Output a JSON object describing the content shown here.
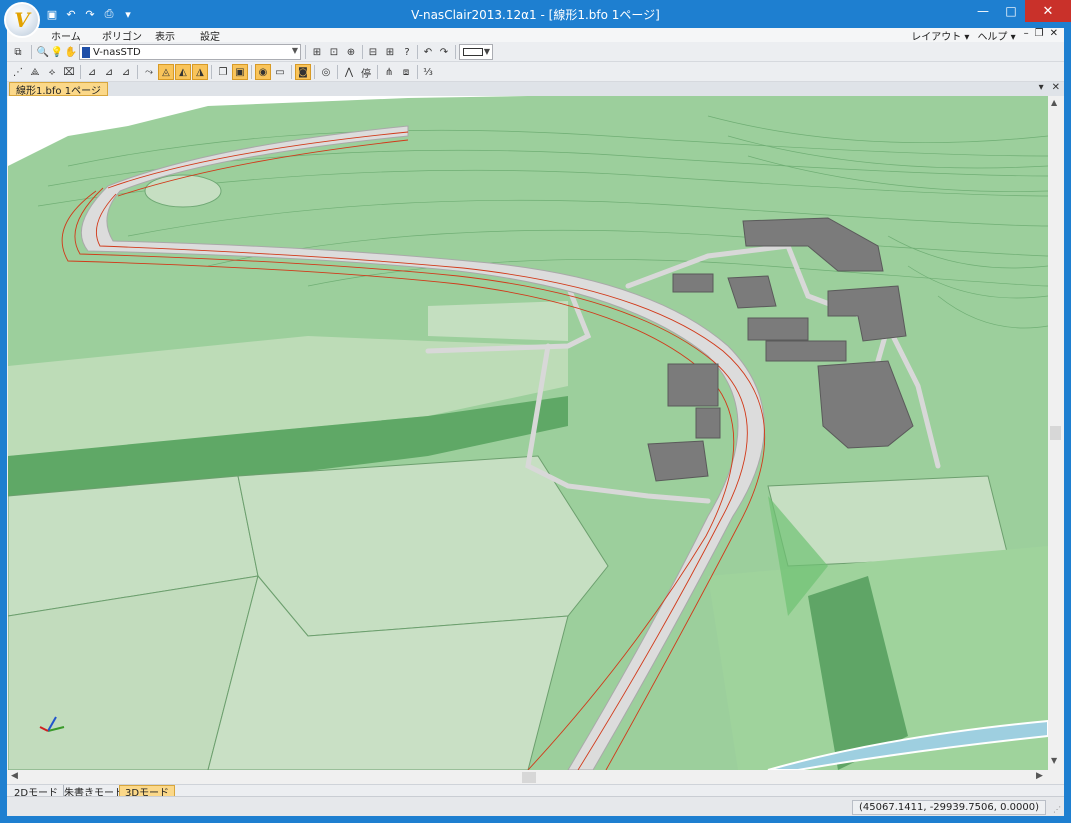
{
  "window": {
    "title": "V-nasClair2013.12α1 - [線形1.bfo 1ページ]",
    "logo_text": "V",
    "controls": {
      "minimize": "—",
      "maximize": "□",
      "close": "✕"
    }
  },
  "menu": {
    "items": [
      "ホーム",
      "ポリゴン",
      "表示",
      "設定"
    ],
    "right": [
      "レイアウト ▾",
      "ヘルプ ▾"
    ],
    "mdi": [
      "–",
      "❐",
      "✕"
    ]
  },
  "toolbar": {
    "layer_name": "V-nasSTD",
    "layer_color": "#1f4fa8"
  },
  "document": {
    "tab_label": "線形1.bfo 1ページ",
    "controls": [
      "▾",
      "✕"
    ]
  },
  "mode_tabs": [
    {
      "label": "2Dモード",
      "active": false
    },
    {
      "label": "朱書きモード",
      "active": false
    },
    {
      "label": "3Dモード",
      "active": true
    }
  ],
  "status": {
    "coordinates": "(45067.1411, -29939.7506, 0.0000)"
  },
  "scene": {
    "terrain_colors": {
      "light": "#c4dfc0",
      "mid": "#8fcf8f",
      "dark": "#55a35f",
      "road": "#d4d4d4",
      "building": "#7c7c7c",
      "alignment": "#d13a1a"
    }
  }
}
